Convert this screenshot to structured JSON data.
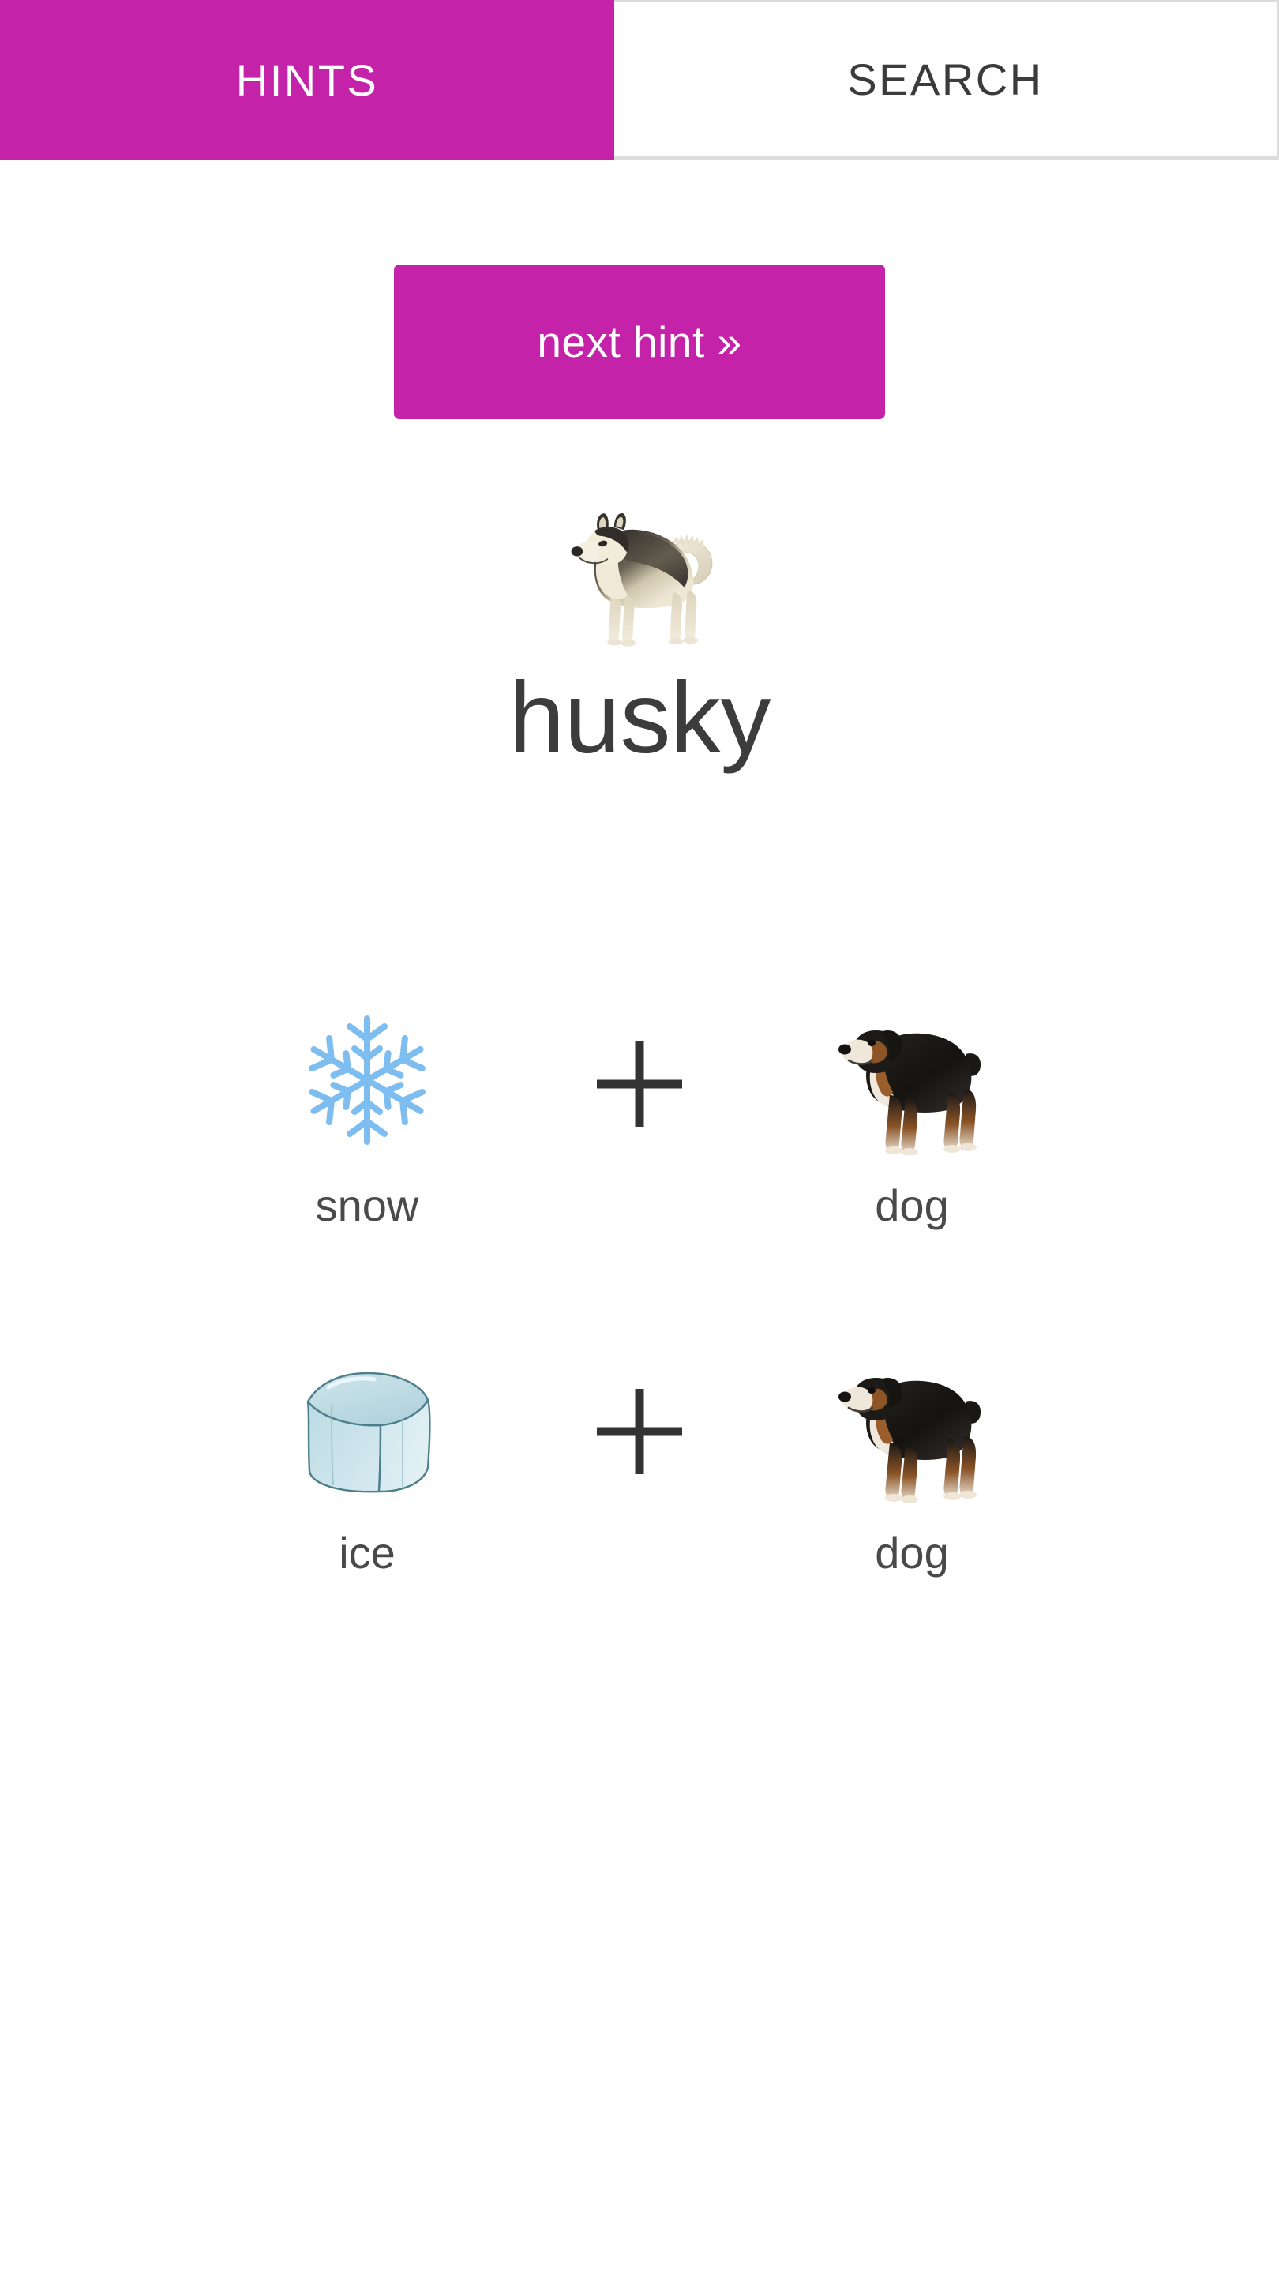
{
  "tabs": [
    {
      "id": "hints",
      "label": "HINTS",
      "active": true,
      "accent": "#c422a8"
    },
    {
      "id": "search",
      "label": "SEARCH",
      "active": false,
      "accent": "#3b3b3b"
    }
  ],
  "toolbar": {
    "next_hint_label": "next hint »"
  },
  "answer": {
    "word": "husky",
    "emoji_name": "husky-dog-emoji"
  },
  "hint_rows": [
    {
      "left": {
        "label": "snow",
        "icon": "snowflake-icon"
      },
      "operator": "+",
      "right": {
        "label": "dog",
        "icon": "dog-icon"
      }
    },
    {
      "left": {
        "label": "ice",
        "icon": "ice-cube-icon"
      },
      "operator": "+",
      "right": {
        "label": "dog",
        "icon": "dog-icon"
      }
    }
  ],
  "colors": {
    "accent_magenta": "#c422a8",
    "text_dark": "#3c3c3c",
    "label_gray": "#4a4a4a",
    "snowflake_blue": "#7ebdf0",
    "ice_blue": "#b9d8e0",
    "tab_border": "#dcdcdc",
    "background": "#ffffff"
  }
}
